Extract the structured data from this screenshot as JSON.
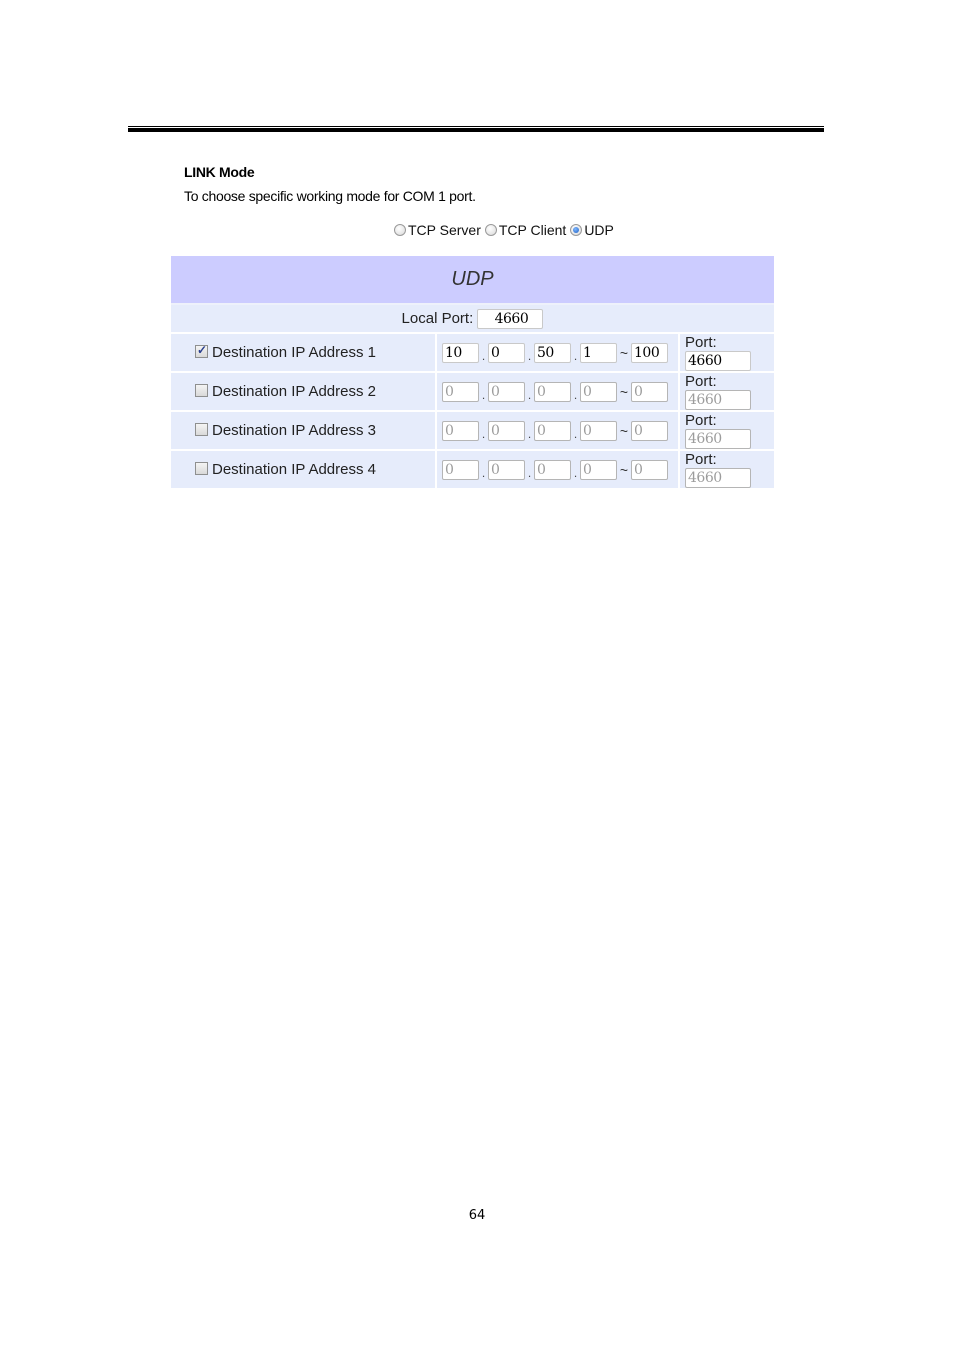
{
  "section": {
    "title": "LINK Mode",
    "description": "To choose specific working mode for COM 1 port."
  },
  "link_mode": {
    "options": [
      {
        "label": "TCP Server",
        "checked": false
      },
      {
        "label": "TCP Client",
        "checked": false
      },
      {
        "label": "UDP",
        "checked": true
      }
    ]
  },
  "udp_table": {
    "header": "UDP",
    "local_port_label": "Local Port:",
    "local_port_value": "4660",
    "port_label": "Port:",
    "range_separator": "~",
    "octet_separator": ".",
    "rows": [
      {
        "label": "Destination IP Address 1",
        "enabled": true,
        "octets": [
          "10",
          "0",
          "50",
          "1"
        ],
        "range_end": "100",
        "port": "4660"
      },
      {
        "label": "Destination IP Address 2",
        "enabled": false,
        "octets": [
          "0",
          "0",
          "0",
          "0"
        ],
        "range_end": "0",
        "port": "4660"
      },
      {
        "label": "Destination IP Address 3",
        "enabled": false,
        "octets": [
          "0",
          "0",
          "0",
          "0"
        ],
        "range_end": "0",
        "port": "4660"
      },
      {
        "label": "Destination IP Address 4",
        "enabled": false,
        "octets": [
          "0",
          "0",
          "0",
          "0"
        ],
        "range_end": "0",
        "port": "4660"
      }
    ]
  },
  "colors": {
    "header_bg": "#ccccff",
    "row_bg": "#e6ecfb"
  },
  "page_number": "64"
}
